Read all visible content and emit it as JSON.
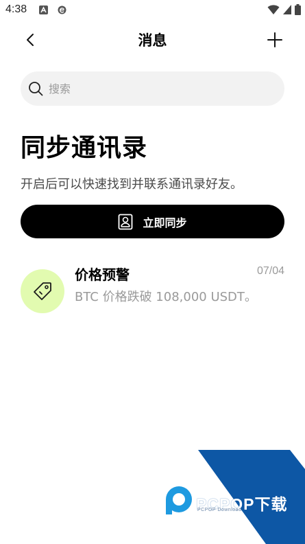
{
  "status_bar": {
    "time": "4:38"
  },
  "header": {
    "title": "消息"
  },
  "search": {
    "placeholder": "搜索"
  },
  "sync": {
    "heading": "同步通讯录",
    "description": "开启后可以快速找到并联系通讯录好友。",
    "button_label": "立即同步"
  },
  "messages": [
    {
      "title": "价格预警",
      "date": "07/04",
      "body": "BTC 价格跌破 108,000 USDT。",
      "icon": "price-tag-icon",
      "avatar_color": "#e2fbb0"
    }
  ],
  "watermark": {
    "text": "PCPOP下载",
    "subtext": "PCPOP Download"
  },
  "colors": {
    "accent": "#000000",
    "search_bg": "#f2f2f2",
    "muted_text": "#9a9a9a",
    "watermark_blue": "#0d57a5"
  }
}
